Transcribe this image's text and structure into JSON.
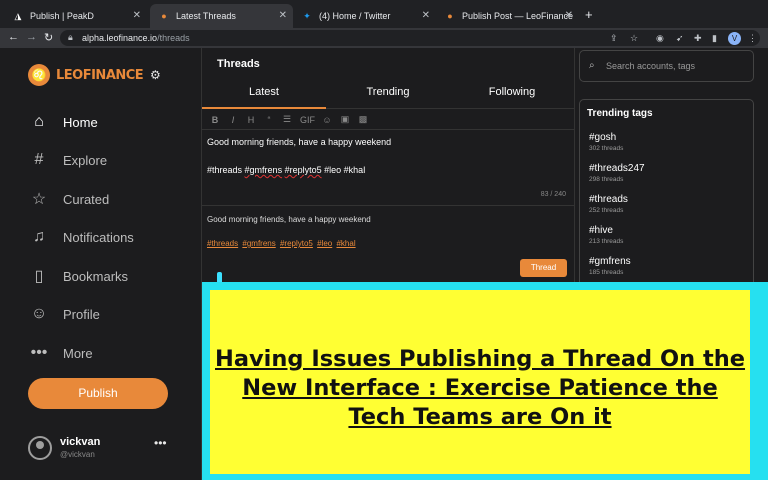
{
  "browser": {
    "tabs": [
      {
        "title": "Publish | PeakD",
        "favicon": "peakd-icon"
      },
      {
        "title": "Latest Threads",
        "favicon": "leofinance-icon"
      },
      {
        "title": "(4) Home / Twitter",
        "favicon": "twitter-icon"
      },
      {
        "title": "Publish Post — LeoFinance",
        "favicon": "leofinance-icon"
      }
    ],
    "url_host": "alpha.leofinance.io",
    "url_path": "/threads",
    "profile_initial": "V"
  },
  "sidebar": {
    "brand": "LEOFINANCE",
    "items": [
      {
        "label": "Home",
        "icon": "home-icon"
      },
      {
        "label": "Explore",
        "icon": "hash-icon"
      },
      {
        "label": "Curated",
        "icon": "star-icon"
      },
      {
        "label": "Notifications",
        "icon": "bell-icon"
      },
      {
        "label": "Bookmarks",
        "icon": "bookmark-icon"
      },
      {
        "label": "Profile",
        "icon": "person-icon"
      },
      {
        "label": "More",
        "icon": "dots-icon"
      }
    ],
    "publish_label": "Publish",
    "user": {
      "name": "vickvan",
      "handle": "@vickvan"
    }
  },
  "main": {
    "title": "Threads",
    "tabs": [
      "Latest",
      "Trending",
      "Following"
    ],
    "editor_tools": [
      "B",
      "I",
      "H",
      "“",
      "☰",
      "GIF",
      "☺",
      "▣",
      "▩"
    ],
    "composer_line1": "Good morning friends, have a happy weekend",
    "composer_line2_tags": [
      "#threads",
      "#gmfrens",
      "#replyto5",
      "#leo",
      "#khal"
    ],
    "char_count": "83 / 240",
    "preview_text": "Good morning friends, have a happy weekend",
    "preview_tags": [
      "#threads",
      "#gmfrens",
      "#replyto5",
      "#leo",
      "#khal"
    ],
    "thread_button": "Thread"
  },
  "right": {
    "search_placeholder": "Search accounts, tags",
    "trending_title": "Trending tags",
    "tags": [
      {
        "name": "#gosh",
        "count": "302 threads"
      },
      {
        "name": "#threads247",
        "count": "298 threads"
      },
      {
        "name": "#threads",
        "count": "252 threads"
      },
      {
        "name": "#hive",
        "count": "213 threads"
      },
      {
        "name": "#gmfrens",
        "count": "185 threads"
      }
    ]
  },
  "banner": {
    "text": "Having Issues Publishing a Thread On the New Interface : Exercise Patience the Tech Teams are On it",
    "border_color": "#26e0f0",
    "fill_color": "#ffff33"
  }
}
